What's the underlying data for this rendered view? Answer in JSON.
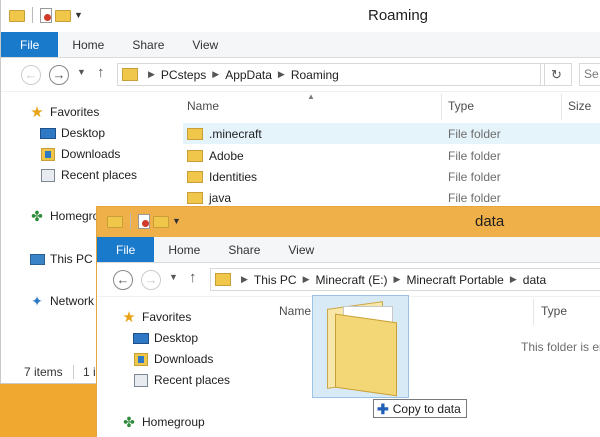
{
  "back_window": {
    "title": "Roaming",
    "ribbon_tabs": [
      "File",
      "Home",
      "Share",
      "View"
    ],
    "breadcrumb": [
      "PCsteps",
      "AppData",
      "Roaming"
    ],
    "search_partial": "Se",
    "sidebar": {
      "favorites": "Favorites",
      "favorites_items": [
        "Desktop",
        "Downloads",
        "Recent places"
      ],
      "homegroup": "Homegroup",
      "this_pc": "This PC",
      "network": "Network"
    },
    "columns": {
      "name": "Name",
      "type": "Type",
      "size": "Size"
    },
    "files": [
      {
        "name": ".minecraft",
        "type": "File folder"
      },
      {
        "name": "Adobe",
        "type": "File folder"
      },
      {
        "name": "Identities",
        "type": "File folder"
      },
      {
        "name": "java",
        "type": "File folder"
      }
    ],
    "status": {
      "items": "7 items",
      "selected": "1 i"
    }
  },
  "front_window": {
    "title": "data",
    "ribbon_tabs": [
      "File",
      "Home",
      "Share",
      "View"
    ],
    "breadcrumb": [
      "This PC",
      "Minecraft (E:)",
      "Minecraft Portable",
      "data"
    ],
    "sidebar": {
      "favorites": "Favorites",
      "favorites_items": [
        "Desktop",
        "Downloads",
        "Recent places"
      ],
      "homegroup": "Homegroup"
    },
    "columns": {
      "name": "Name",
      "type": "Type"
    },
    "empty_message": "This folder is er"
  },
  "drag": {
    "tooltip": "Copy to data"
  },
  "colors": {
    "accent": "#1979ca",
    "front_titlebar": "#f0b049",
    "desktop": "#f0a830"
  }
}
